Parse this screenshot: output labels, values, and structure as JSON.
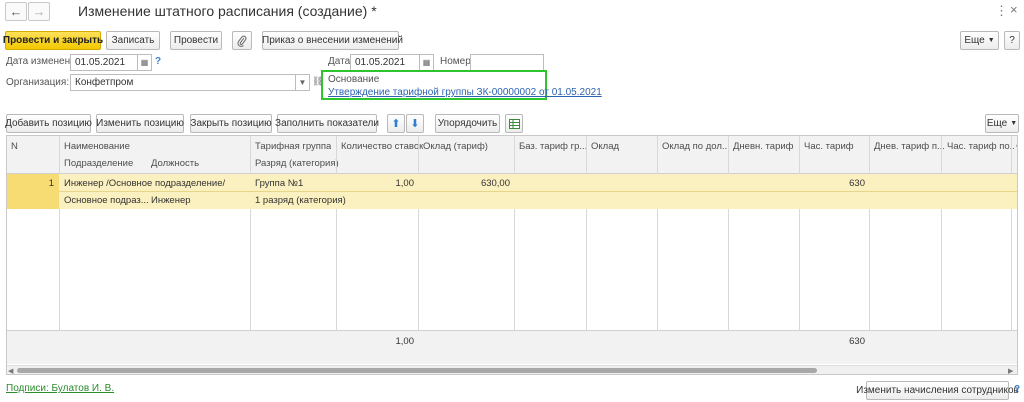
{
  "window": {
    "title": "Изменение штатного расписания (создание) *"
  },
  "toolbar": {
    "post_close": "Провести и закрыть",
    "save": "Записать",
    "post": "Провести",
    "order": "Приказ о внесении изменений",
    "more": "Еще"
  },
  "form": {
    "change_date_label": "Дата изменений:",
    "change_date_value": "01.05.2021",
    "date_label": "Дата:",
    "date_value": "01.05.2021",
    "number_label": "Номер:",
    "number_value": "",
    "org_label": "Организация:",
    "org_value": "Конфетпром",
    "basis_label": "Основание",
    "basis_link": "Утверждение тарифной группы ЗК-00000002 от 01.05.2021"
  },
  "table_toolbar": {
    "add": "Добавить позицию",
    "edit": "Изменить позицию",
    "close": "Закрыть позицию",
    "fill": "Заполнить показатели",
    "sort": "Упорядочить",
    "more": "Еще"
  },
  "table": {
    "headers": {
      "n": "N",
      "name": "Наименование",
      "division": "Подразделение",
      "position": "Должность",
      "tariff_group": "Тарифная группа",
      "category": "Разряд (категория)",
      "rate_count": "Количество ставок",
      "salary_tariff": "Оклад (тариф)",
      "base_tariff": "Баз. тариф гр...",
      "salary": "Оклад",
      "salary_by": "Оклад по дол...",
      "daily_tariff": "Дневн. тариф",
      "hour_tariff": "Час. тариф",
      "daily_tariff_p": "Днев. тариф п...",
      "hour_tariff_p": "Час. тариф по...",
      "extra": "Ф"
    },
    "row": {
      "n": "1",
      "name": "Инженер /Основное подразделение/",
      "division": "Основное подраз...",
      "position": "Инженер",
      "tariff_group": "Группа №1",
      "category": "1 разряд (категория)",
      "rate_count": "1,00",
      "salary_tariff": "630,00",
      "hour_tariff": "630"
    },
    "totals": {
      "rate_count": "1,00",
      "hour_tariff": "630"
    }
  },
  "bottom": {
    "signatures": "Подписи: Булатов И. В.",
    "change_accruals": "Изменить начисления сотрудников"
  },
  "colors": {
    "accent": "#f3c800",
    "highlight": "#2ec42e",
    "row": "#fbf0bf"
  }
}
